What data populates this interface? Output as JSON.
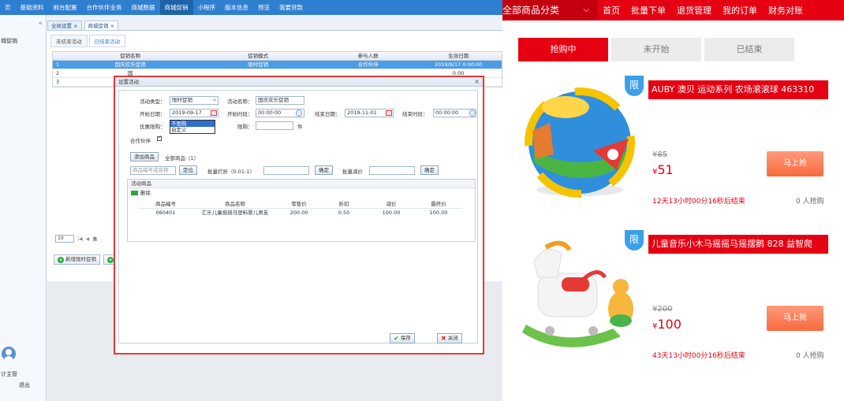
{
  "admin": {
    "topnav": [
      "页",
      "基础资料",
      "前台配置",
      "合作伙伴业务",
      "商城数据",
      "商城促销",
      "小程序",
      "版本信息",
      "预览",
      "我要贷款"
    ],
    "topnav_active": 5,
    "sidebar": {
      "collapse": "«",
      "label": "城促销",
      "user": "计主管",
      "logout": "退出"
    },
    "tabs": [
      "全局设置 ×",
      "商城促销 ×"
    ],
    "subtabs": [
      "未结束活动",
      "已结束活动"
    ],
    "grid": {
      "headers": [
        "",
        "促销名称",
        "促销模式",
        "参与人群",
        "生效日期"
      ],
      "rows": [
        [
          "1",
          "国庆欢乐促销",
          "限时促销",
          "合作伙伴",
          "2019/9/17 0:00:00"
        ],
        [
          "2",
          "国",
          "",
          "",
          "0:00"
        ],
        [
          "3",
          "国庆",
          "",
          "",
          "0:00"
        ]
      ]
    },
    "pager": {
      "size": "10",
      "first": "|◀",
      "prev": "◀",
      "text": "第"
    },
    "bottom_buttons": [
      "新增限时促销",
      ""
    ],
    "modal": {
      "title": "设置活动",
      "close": "×",
      "type_label": "活动类型：",
      "type_value": "限时促销",
      "name_label": "活动名称：",
      "name_value": "国庆欢乐促销",
      "start_date_label": "开始日期：",
      "start_date": "2019-09-17",
      "start_time_label": "开始时段：",
      "start_time": "00:00:00",
      "end_date_label": "结束日期：",
      "end_date": "2019-11-01",
      "end_time_label": "结束时段：",
      "end_time": "00:00:00",
      "limit_label": "优惠限购：",
      "limit_options": [
        "不限购",
        "自定义"
      ],
      "qty_label": "限购：",
      "qty_unit": "件",
      "partner_label": "合作伙伴",
      "add_product": "添加商品",
      "all_products": "全部商品（1）",
      "search_placeholder": "商品编号或名称",
      "locate": "定位",
      "batch_discount_label": "批量打折（0.01-1）",
      "confirm1": "确定",
      "batch_reduce_label": "批量减价",
      "confirm2": "确定",
      "section_title": "活动商品",
      "delete": "删除",
      "product_headers": [
        "商品编号",
        "商品名称",
        "零售价",
        "折扣",
        "减价",
        "最终价"
      ],
      "products": [
        [
          "060401",
          "汇乐儿童摇摇马塑料婴儿男友",
          "200.00",
          "0.50",
          "100.00",
          "100.00"
        ]
      ],
      "save": "保存",
      "close_btn": "关闭"
    }
  },
  "shop": {
    "category": "全部商品分类",
    "nav": [
      "首页",
      "批量下单",
      "退货管理",
      "我的订单",
      "财务对账"
    ],
    "flash_tabs": [
      "抢购中",
      "未开始",
      "已结束"
    ],
    "products": [
      {
        "badge": "限",
        "title": "AUBY 澳贝 运动系列 农场滚滚球 463310",
        "old_price": "¥85",
        "currency": "¥",
        "price": "51",
        "buy": "马上抢",
        "countdown": "12天13小时00分16秒后结束",
        "count": "0 人抢购"
      },
      {
        "badge": "限",
        "title": "儿童音乐小木马摇摇马摇摆鹅 828 益智爬",
        "old_price": "¥200",
        "currency": "¥",
        "price": "100",
        "buy": "马上抢",
        "countdown": "43天13小时00分16秒后结束",
        "count": "0 人抢购"
      }
    ]
  }
}
